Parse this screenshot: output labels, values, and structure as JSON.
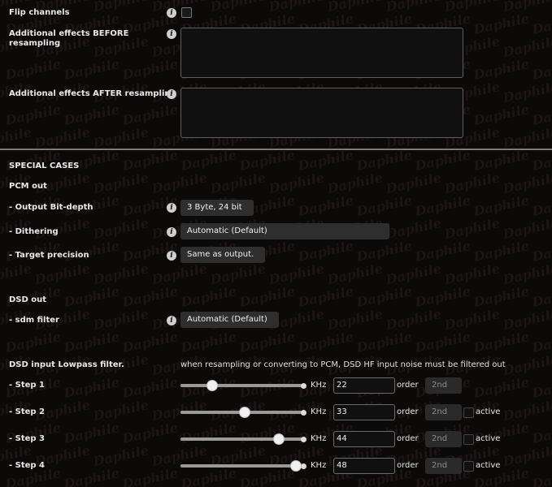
{
  "watermark": "Daphile",
  "effects": {
    "flip_channels": "Flip channels",
    "before_line1": "Additional effects BEFORE",
    "before_line2": "resampling",
    "after": "Additional effects AFTER resampling"
  },
  "info_glyph": "i",
  "special": {
    "heading": "SPECIAL CASES",
    "pcm_heading": "PCM out",
    "bit_depth_label": "- Output Bit-depth",
    "bit_depth_value": "3 Byte, 24 bit",
    "dithering_label": "- Dithering",
    "dithering_value": "Automatic (Default)",
    "precision_label": "- Target precision",
    "precision_value": "Same as output.",
    "dsd_heading": "DSD out",
    "sdm_label": "- sdm filter",
    "sdm_value": "Automatic (Default)"
  },
  "lowpass": {
    "heading": "DSD input Lowpass filter.",
    "note": "when resampling or converting to PCM, DSD HF input noise must be filtered out",
    "unit": "KHz",
    "order_label": "order",
    "active_label": "active",
    "steps": [
      {
        "label": "- Step 1",
        "value": "22",
        "order": "2nd",
        "slider_level": 0.25,
        "has_active": false
      },
      {
        "label": "- Step 2",
        "value": "33",
        "order": "2nd",
        "slider_level": 0.52,
        "has_active": true
      },
      {
        "label": "- Step 3",
        "value": "44",
        "order": "2nd",
        "slider_level": 0.8,
        "has_active": true
      },
      {
        "label": "- Step 4",
        "value": "48",
        "order": "2nd",
        "slider_level": 0.94,
        "has_active": true
      }
    ]
  }
}
